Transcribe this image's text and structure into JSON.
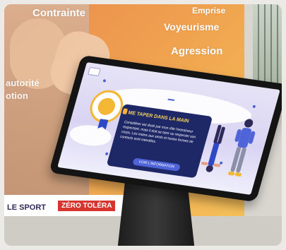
{
  "poster": {
    "words": [
      "Contrainte",
      "Emprise",
      "Voyeurisme",
      "Agression",
      "autorité",
      "otion"
    ],
    "bottom_left": "LE SPORT",
    "tolerance_banner": "ZÉRO TOLÉRA"
  },
  "kiosk": {
    "header_button": "",
    "panel": {
      "title": "ME TAPER DANS LA MAIN",
      "body": "Considérer est dicté par mon rôle l'entraîneur respectant, mais il doit se taire ou respecter son corps. Les mains aux seuls et toutes formes de contacts sont interdites.",
      "button": "VOIR L'INFORMATION"
    }
  },
  "colors": {
    "panel_bg": "#1f2866",
    "accent_blue": "#4f64d8",
    "badge_gold": "#f3b733",
    "tolerance_red": "#d6342c"
  }
}
